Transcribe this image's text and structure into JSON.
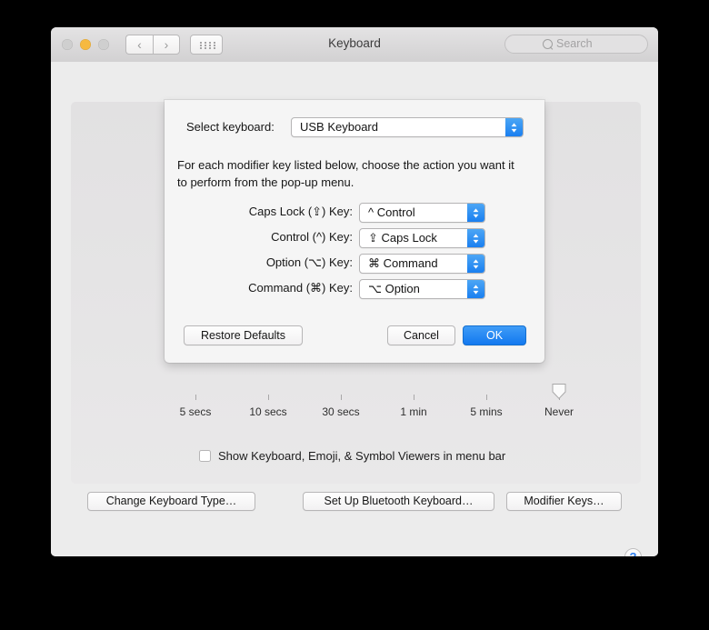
{
  "window": {
    "title": "Keyboard",
    "traffic_lights": [
      "close",
      "minimize",
      "zoom"
    ],
    "nav": {
      "back": "‹",
      "forward": "›"
    },
    "search": {
      "placeholder": "Search",
      "value": ""
    }
  },
  "main": {
    "slider": {
      "ticks": [
        "5 secs",
        "10 secs",
        "30 secs",
        "1 min",
        "5 mins",
        "Never"
      ],
      "value": "Never"
    },
    "checkbox": {
      "label": "Show Keyboard, Emoji, & Symbol Viewers in menu bar",
      "checked": false
    },
    "buttons": {
      "change_keyboard_type": "Change Keyboard Type…",
      "setup_bluetooth": "Set Up Bluetooth Keyboard…",
      "modifier_keys": "Modifier Keys…"
    },
    "help": "?"
  },
  "sheet": {
    "select_keyboard_label": "Select keyboard:",
    "select_keyboard_value": "USB Keyboard",
    "description": "For each modifier key listed below, choose the action you want it to perform from the pop-up menu.",
    "rows": [
      {
        "label": "Caps Lock (⇪) Key:",
        "value": "^ Control"
      },
      {
        "label": "Control (^) Key:",
        "value": "⇪ Caps Lock"
      },
      {
        "label": "Option (⌥) Key:",
        "value": "⌘ Command"
      },
      {
        "label": "Command (⌘) Key:",
        "value": "⌥ Option"
      }
    ],
    "restore_defaults": "Restore Defaults",
    "cancel": "Cancel",
    "ok": "OK"
  },
  "colors": {
    "accent_blue": "#1278ef",
    "window_bg": "#ececec",
    "panel_bg": "#e6e5e6",
    "sheet_bg": "#f5f5f5",
    "minimize_yellow": "#f6b940"
  }
}
